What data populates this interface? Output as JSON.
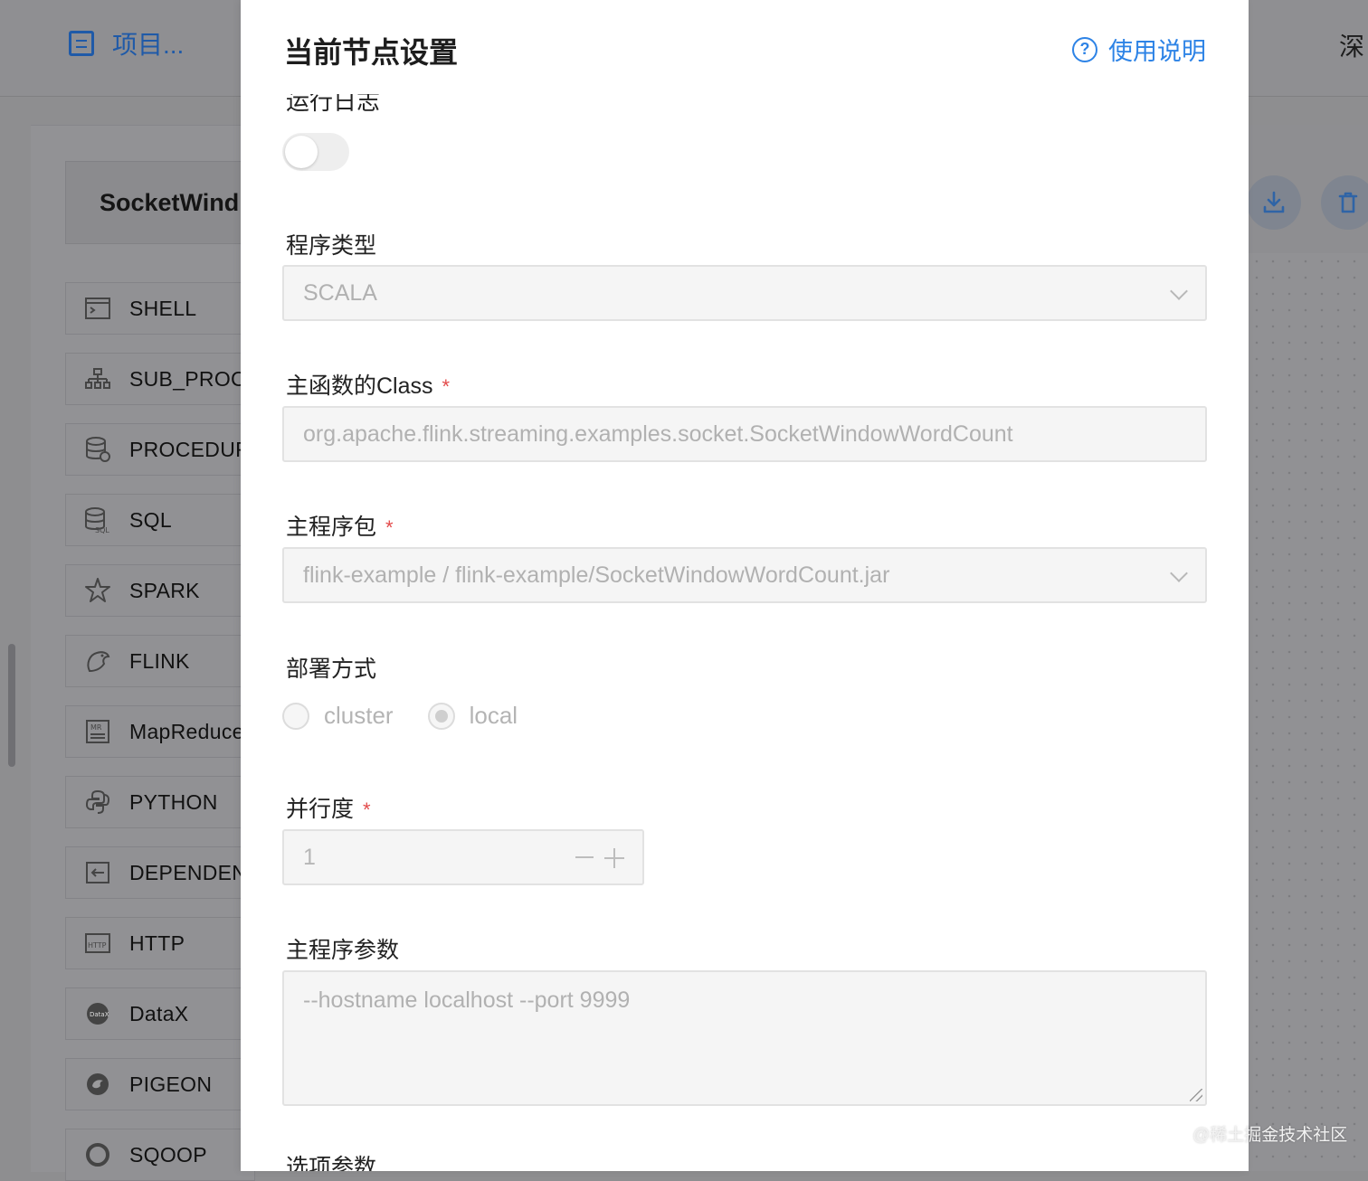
{
  "topbar": {
    "project_label": "项目...",
    "right_text": "深"
  },
  "workflow": {
    "title": "SocketWind"
  },
  "task_types": [
    {
      "label": "SHELL",
      "icon": "terminal-icon"
    },
    {
      "label": "SUB_PROC",
      "icon": "sub-process-icon"
    },
    {
      "label": "PROCEDUR",
      "icon": "procedure-icon"
    },
    {
      "label": "SQL",
      "icon": "sql-icon"
    },
    {
      "label": "SPARK",
      "icon": "spark-icon"
    },
    {
      "label": "FLINK",
      "icon": "flink-icon"
    },
    {
      "label": "MapReduce",
      "icon": "mapreduce-icon"
    },
    {
      "label": "PYTHON",
      "icon": "python-icon"
    },
    {
      "label": "DEPENDENT",
      "icon": "dependent-icon"
    },
    {
      "label": "HTTP",
      "icon": "http-icon"
    },
    {
      "label": "DataX",
      "icon": "datax-icon"
    },
    {
      "label": "PIGEON",
      "icon": "pigeon-icon"
    },
    {
      "label": "SQOOP",
      "icon": "sqoop-icon"
    }
  ],
  "canvas_actions": {
    "download_icon": "download-icon",
    "delete_icon": "trash-icon"
  },
  "drawer": {
    "title": "当前节点设置",
    "help_label": "使用说明",
    "cut_label": "运行日志",
    "fields": {
      "program_type": {
        "label": "程序类型",
        "value": "SCALA"
      },
      "main_class": {
        "label": "主函数的Class",
        "required_mark": "*",
        "value": "org.apache.flink.streaming.examples.socket.SocketWindowWordCount"
      },
      "main_package": {
        "label": "主程序包",
        "required_mark": "*",
        "value": "flink-example / flink-example/SocketWindowWordCount.jar"
      },
      "deploy_mode": {
        "label": "部署方式",
        "options": [
          "cluster",
          "local"
        ],
        "selected": "local"
      },
      "parallelism": {
        "label": "并行度",
        "required_mark": "*",
        "value": "1"
      },
      "main_args": {
        "label": "主程序参数",
        "value": "--hostname localhost --port 9999"
      },
      "option_params": {
        "label": "选项参数"
      }
    }
  },
  "watermark": "@稀土掘金技术社区",
  "colors": {
    "accent": "#2d83e6",
    "required": "#e34b4b",
    "overlay": "#8e8e90"
  }
}
